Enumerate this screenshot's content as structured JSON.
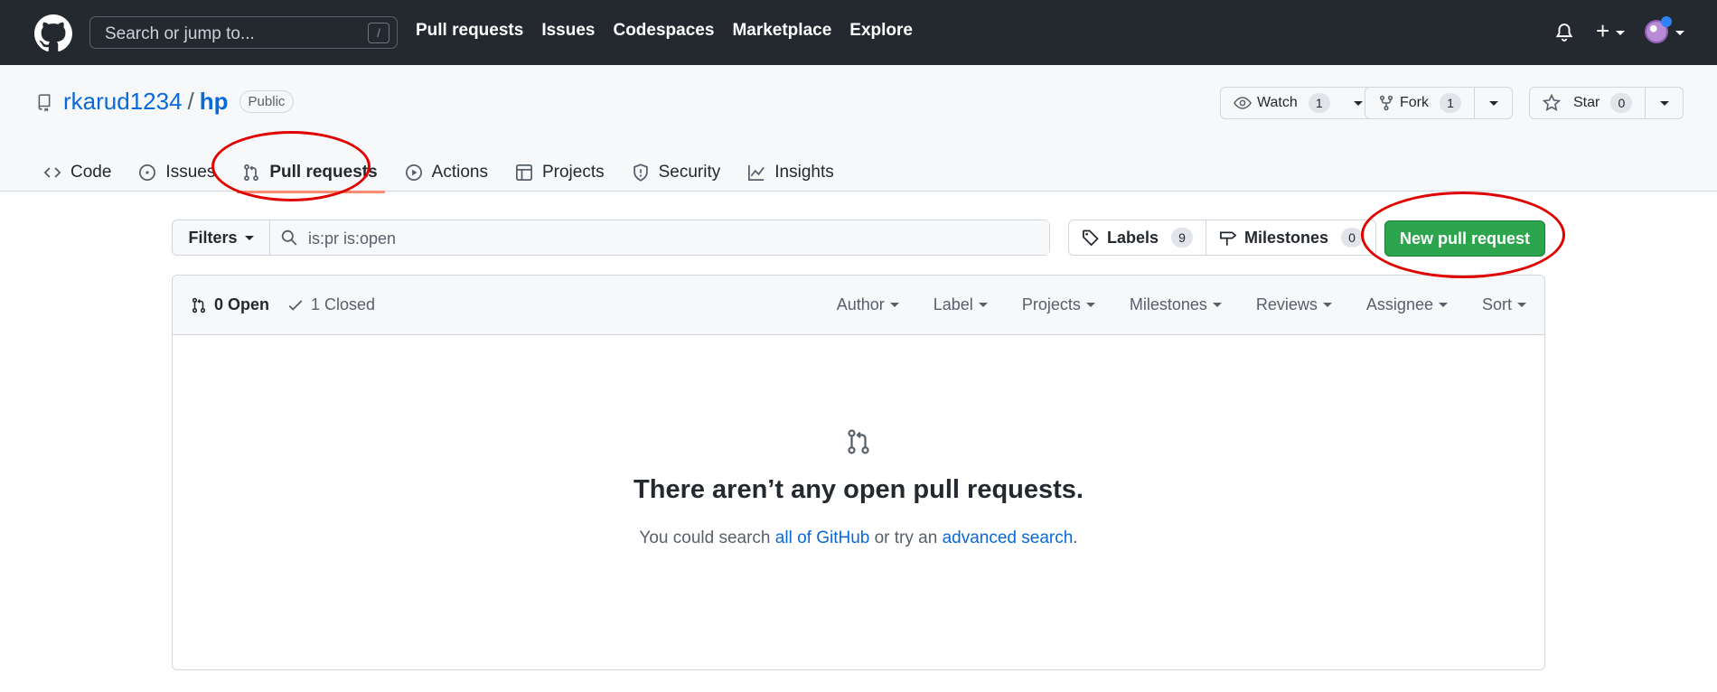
{
  "header": {
    "search_placeholder": "Search or jump to...",
    "search_key": "/",
    "nav": [
      "Pull requests",
      "Issues",
      "Codespaces",
      "Marketplace",
      "Explore"
    ],
    "plus": "+"
  },
  "repo": {
    "owner": "rkarud1234",
    "separator": "/",
    "name": "hp",
    "visibility": "Public",
    "watch": {
      "label": "Watch",
      "count": "1"
    },
    "fork": {
      "label": "Fork",
      "count": "1"
    },
    "star": {
      "label": "Star",
      "count": "0"
    }
  },
  "tabs": [
    {
      "label": "Code"
    },
    {
      "label": "Issues"
    },
    {
      "label": "Pull requests"
    },
    {
      "label": "Actions"
    },
    {
      "label": "Projects"
    },
    {
      "label": "Security"
    },
    {
      "label": "Insights"
    }
  ],
  "toolbar": {
    "filters_label": "Filters",
    "filter_value": "is:pr is:open",
    "labels_label": "Labels",
    "labels_count": "9",
    "milestones_label": "Milestones",
    "milestones_count": "0",
    "new_pr_label": "New pull request"
  },
  "list": {
    "open_label": "0 Open",
    "closed_label": "1 Closed",
    "sorters": [
      "Author",
      "Label",
      "Projects",
      "Milestones",
      "Reviews",
      "Assignee",
      "Sort"
    ]
  },
  "blank": {
    "title": "There aren’t any open pull requests.",
    "sub_prefix": "You could search ",
    "sub_link1": "all of GitHub",
    "sub_middle": " or try an ",
    "sub_link2": "advanced search",
    "sub_suffix": "."
  },
  "colors": {
    "header_bg": "#24292f",
    "link": "#0969da",
    "primary_button": "#2da44e",
    "annotation": "#e00000"
  }
}
